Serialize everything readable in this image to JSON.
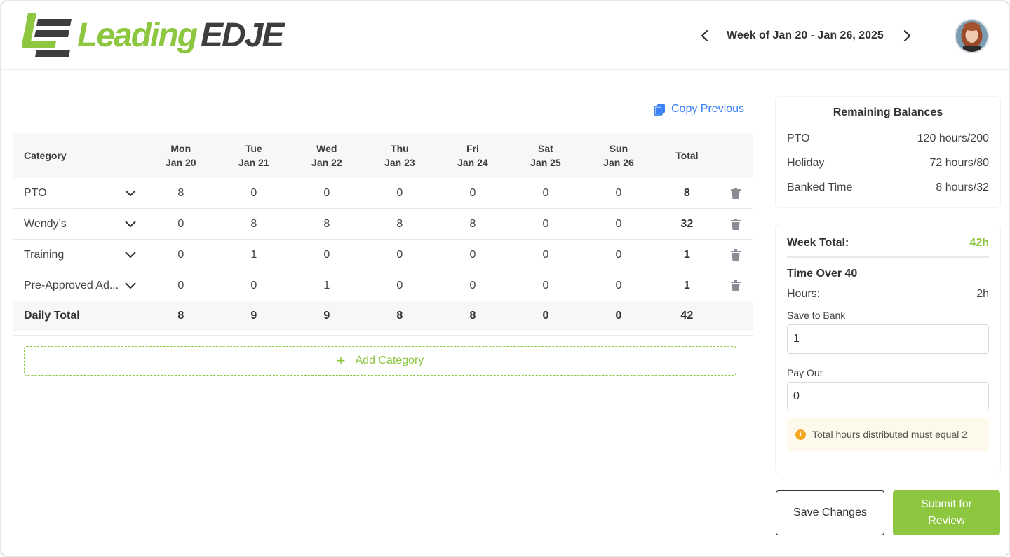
{
  "brand": {
    "name_part1": "Leading",
    "name_part2": "EDJE",
    "green": "#8dc63f",
    "dark": "#3d3e40"
  },
  "header": {
    "week_label": "Week of Jan 20 - Jan 26, 2025",
    "prev_icon": "chevron-left-icon",
    "next_icon": "chevron-right-icon"
  },
  "toolbar": {
    "copy_previous": "Copy Previous"
  },
  "table": {
    "columns": [
      {
        "day": "Category",
        "date": ""
      },
      {
        "day": "Mon",
        "date": "Jan 20"
      },
      {
        "day": "Tue",
        "date": "Jan 21"
      },
      {
        "day": "Wed",
        "date": "Jan 22"
      },
      {
        "day": "Thu",
        "date": "Jan 23"
      },
      {
        "day": "Fri",
        "date": "Jan 24"
      },
      {
        "day": "Sat",
        "date": "Jan 25"
      },
      {
        "day": "Sun",
        "date": "Jan 26"
      },
      {
        "day": "Total",
        "date": ""
      }
    ],
    "rows": [
      {
        "category": "PTO",
        "hours": [
          "8",
          "0",
          "0",
          "0",
          "0",
          "0",
          "0"
        ],
        "total": "8"
      },
      {
        "category": "Wendy’s",
        "hours": [
          "0",
          "8",
          "8",
          "8",
          "8",
          "0",
          "0"
        ],
        "total": "32"
      },
      {
        "category": "Training",
        "hours": [
          "0",
          "1",
          "0",
          "0",
          "0",
          "0",
          "0"
        ],
        "total": "1"
      },
      {
        "category": "Pre-Approved Ad...",
        "hours": [
          "0",
          "0",
          "1",
          "0",
          "0",
          "0",
          "0"
        ],
        "total": "1"
      }
    ],
    "daily_total": {
      "label": "Daily Total",
      "hours": [
        "8",
        "9",
        "9",
        "8",
        "8",
        "0",
        "0"
      ],
      "total": "42"
    }
  },
  "add_category": {
    "label": "Add Category"
  },
  "balances": {
    "title": "Remaining Balances",
    "items": [
      {
        "label": "PTO",
        "value": "120 hours/200"
      },
      {
        "label": "Holiday",
        "value": "72 hours/80"
      },
      {
        "label": "Banked Time",
        "value": "8 hours/32"
      }
    ]
  },
  "week_summary": {
    "total_label": "Week Total:",
    "total_value": "42h",
    "over_title": "Time Over 40",
    "hours_label": "Hours:",
    "hours_value": "2h",
    "save_to_bank_label": "Save to Bank",
    "save_to_bank_value": "1",
    "pay_out_label": "Pay Out",
    "pay_out_value": "0",
    "notice": "Total hours distributed must equal 2"
  },
  "actions": {
    "save": "Save Changes",
    "submit": "Submit for Review"
  }
}
